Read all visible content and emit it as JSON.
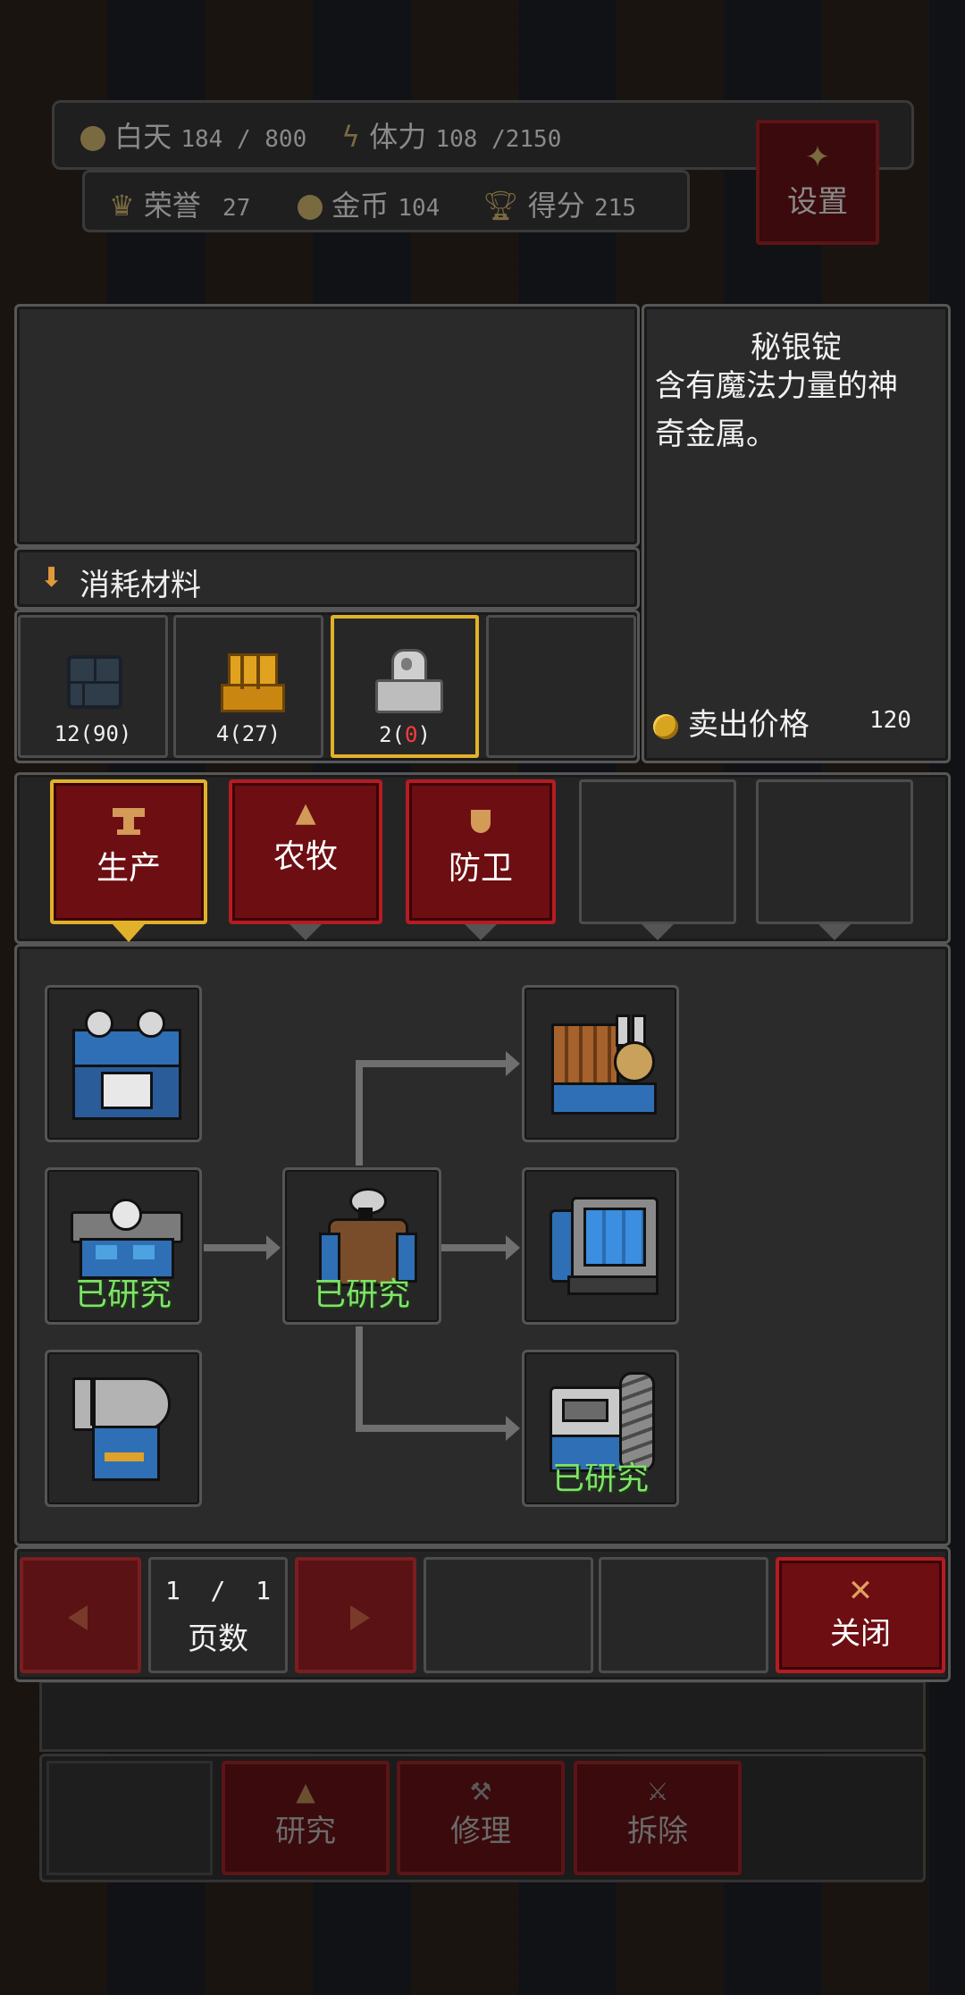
{
  "status": {
    "day_label": "白天",
    "day_value": "184 / 800",
    "stamina_label": "体力",
    "stamina_value": "108 /2150",
    "honor_label": "荣誉",
    "honor_value": "27",
    "gold_label": "金币",
    "gold_value": "104",
    "score_label": "得分",
    "score_value": "215",
    "settings_label": "设置"
  },
  "item_info": {
    "name": "秘银锭",
    "description": "含有魔法力量的神奇金属。",
    "sell_label": "卖出价格",
    "sell_value": "120"
  },
  "materials": {
    "header": "消耗材料",
    "slots": [
      {
        "icon": "stone-brick-icon",
        "label": "12(90)",
        "selected": false
      },
      {
        "icon": "gold-ingot-icon",
        "label": "4(27)",
        "selected": false
      },
      {
        "icon": "silver-ore-icon",
        "label_prefix": "2(",
        "label_red": "0",
        "label_suffix": ")",
        "selected": true
      },
      {
        "icon": "",
        "label": "",
        "selected": false
      }
    ]
  },
  "tabs": [
    {
      "label": "生产",
      "icon": "anvil-icon",
      "active": true
    },
    {
      "label": "农牧",
      "icon": "tree-icon",
      "active": false
    },
    {
      "label": "防卫",
      "icon": "shield-icon",
      "active": false
    }
  ],
  "tech_tree": {
    "researched_label": "已研究"
  },
  "pager": {
    "page": "1  /  1",
    "page_label": "页数",
    "close_label": "关闭"
  },
  "bottom_actions": {
    "research": "研究",
    "repair": "修理",
    "demolish": "拆除"
  },
  "colors": {
    "accent_red": "#b51c22",
    "selected_gold": "#e2b12a",
    "researched_green": "#7fe36a"
  }
}
